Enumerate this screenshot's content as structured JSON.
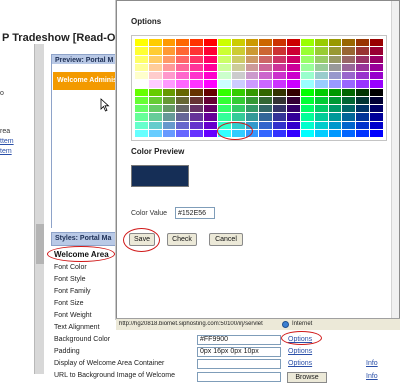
{
  "background": {
    "page_title": "P Tradeshow [Read-Only]",
    "left_links": [
      "ttem",
      "tem"
    ],
    "left_text": [
      "o",
      "rea"
    ],
    "preview_header": "Preview: Portal M",
    "welcome_banner": "Welcome Adminis",
    "styles_header": "Styles: Portal Ma",
    "welcome_area_label": "Welcome Area",
    "style_rows": [
      "Font Color",
      "Font Style",
      "Font Family",
      "Font Size",
      "Font Weight",
      "Text Alignment",
      "Background Color",
      "Padding",
      "Display of Welcome Area Container",
      "URL to Background Image of Welcome"
    ],
    "background_color_value": "#FF9900",
    "padding_value": "0px 16px 0px 10px",
    "options_label": "Options",
    "info_label": "Info",
    "browse_label": "Browse"
  },
  "popup": {
    "options_title": "Options",
    "color_preview_label": "Color Preview",
    "color_value_label": "Color Value",
    "color_value": "#152E56",
    "preview_color": "#152E56",
    "save_label": "Save",
    "check_label": "Check",
    "cancel_label": "Cancel",
    "palette_columns": 18,
    "palette_rows": 12
  },
  "statusbar": {
    "url": "http://hg20818.biomet.siphosting.com:50100/irj/servlet",
    "zone": "Internet"
  },
  "colors": {
    "accent_orange": "#f39a00",
    "header_blue": "#b9c9e6",
    "annotation_red": "#d01818"
  }
}
